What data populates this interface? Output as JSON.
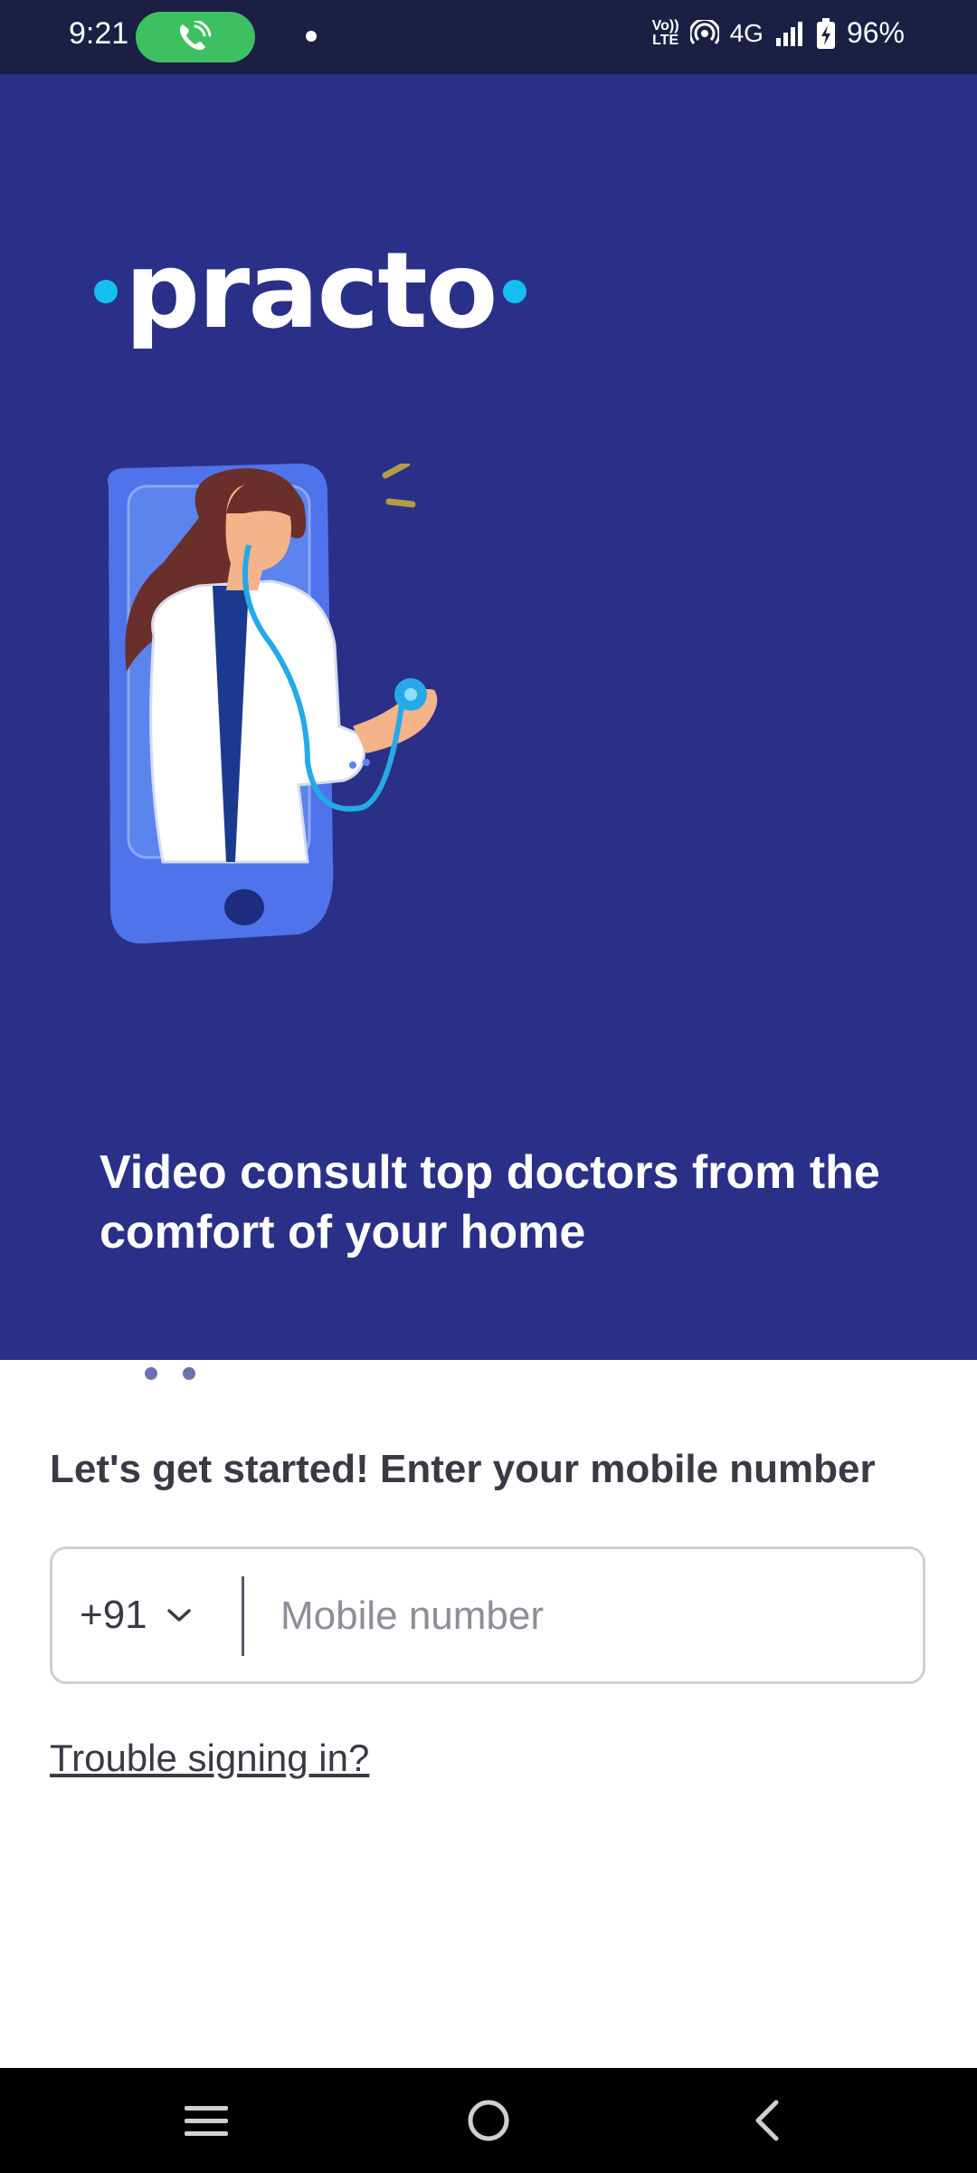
{
  "status_bar": {
    "time": "9:21",
    "network_label": "4G",
    "volte_top": "Vo))",
    "volte_bottom": "LTE",
    "battery": "96%"
  },
  "hero": {
    "logo_text": "practo",
    "title": "Video consult top doctors from the comfort of your home",
    "pager": {
      "count": 3,
      "active_index": 0
    },
    "colors": {
      "background": "#2a3087",
      "accent": "#14bef0"
    }
  },
  "login": {
    "prompt": "Let's get started! Enter your mobile number",
    "country_code": "+91",
    "mobile_placeholder": "Mobile number",
    "mobile_value": "",
    "trouble_link": "Trouble signing in?"
  },
  "nav_bar": {
    "icons": [
      "menu-icon",
      "home-icon",
      "back-icon"
    ]
  }
}
